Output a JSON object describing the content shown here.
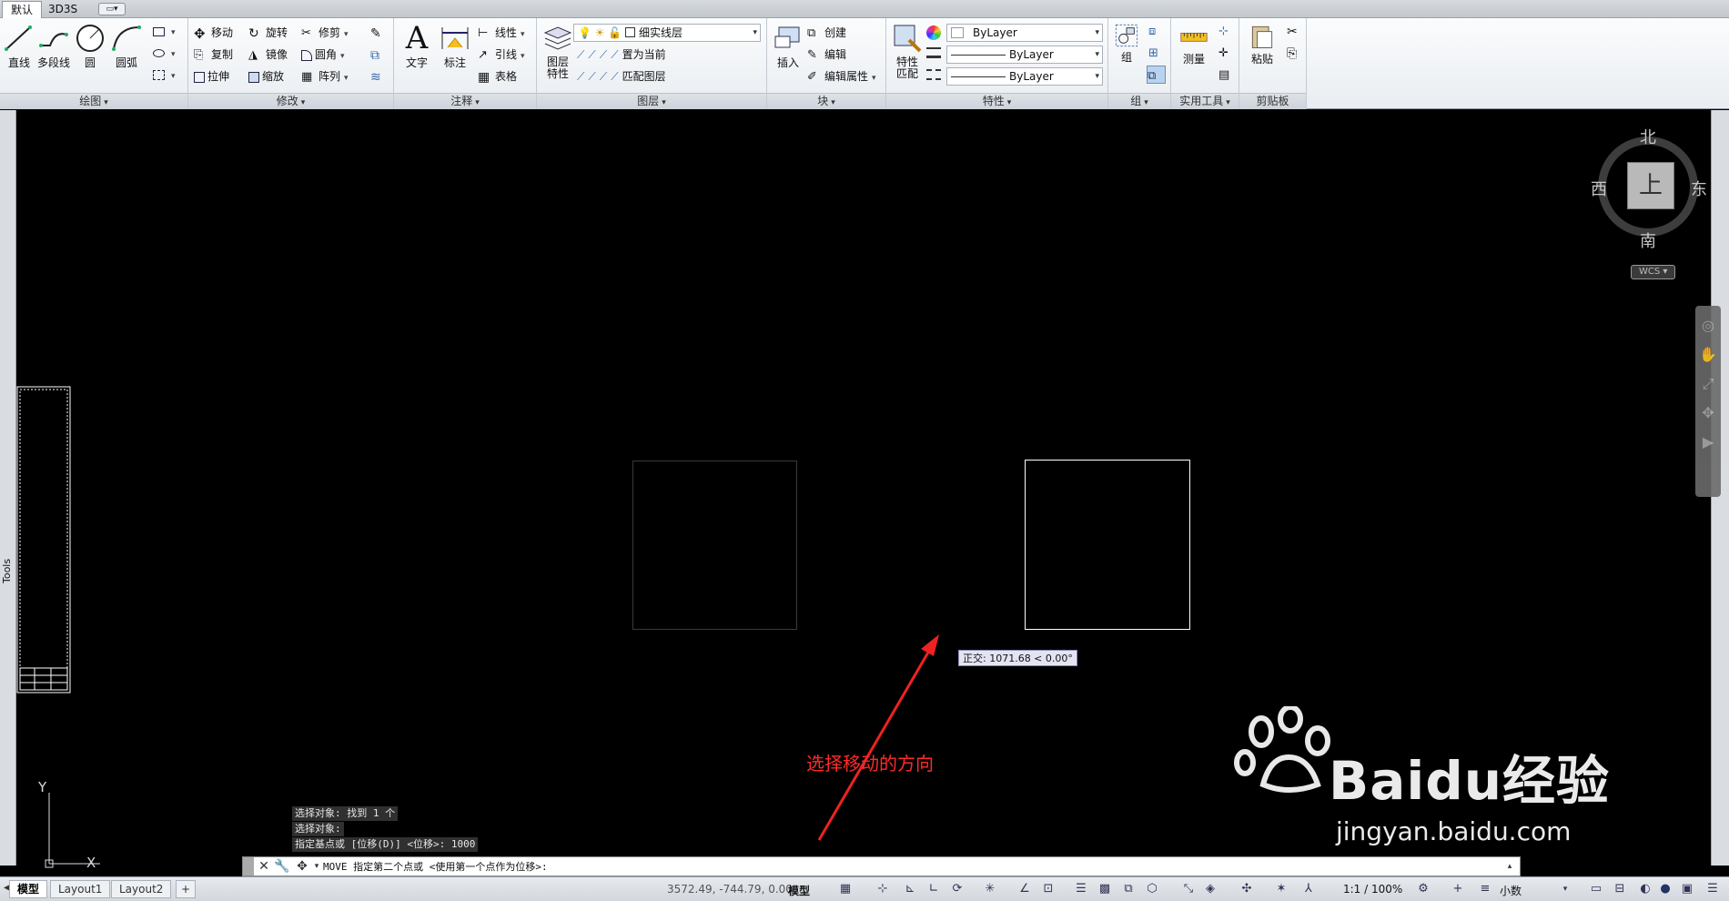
{
  "tabs": [
    "默认",
    "3D3S"
  ],
  "ribbon": {
    "draw": {
      "title": "绘图",
      "line": "直线",
      "polyline": "多段线",
      "circle": "圆",
      "arc": "圆弧"
    },
    "modify": {
      "title": "修改",
      "move": "移动",
      "rotate": "旋转",
      "trim": "修剪",
      "copy": "复制",
      "mirror": "镜像",
      "fillet": "圆角",
      "stretch": "拉伸",
      "scale": "缩放",
      "array": "阵列"
    },
    "annotation": {
      "title": "注释",
      "text": "文字",
      "dimension": "标注",
      "linear": "线性",
      "leader": "引线",
      "table": "表格"
    },
    "layers": {
      "title": "图层",
      "layer_props": "图层\n特性",
      "layer_combo": "细实线层",
      "set_current": "置为当前",
      "match_layer": "匹配图层"
    },
    "block": {
      "title": "块",
      "insert": "插入",
      "create": "创建",
      "edit": "编辑",
      "edit_attr": "编辑属性"
    },
    "properties": {
      "title": "特性",
      "match": "特性\n匹配",
      "color": "ByLayer",
      "lineweight": "ByLayer",
      "linetype": "ByLayer"
    },
    "groups": {
      "title": "组",
      "group": "组"
    },
    "utilities": {
      "title": "实用工具",
      "measure": "测量"
    },
    "clipboard": {
      "title": "剪贴板",
      "paste": "粘贴"
    }
  },
  "left_palette": "Tools",
  "viewcube": {
    "north": "北",
    "south": "南",
    "west": "西",
    "east": "东",
    "face": "上",
    "wcs": "WCS"
  },
  "canvas": {
    "tooltip": "正交: 1071.68 < 0.00°",
    "annotation": "选择移动的方向",
    "ucs_y": "Y",
    "ucs_x": "X"
  },
  "history": [
    "选择对象: 找到 1 个",
    "选择对象:",
    "指定基点或 [位移(D)] <位移>:  1000"
  ],
  "command_line": "MOVE 指定第二个点或 <使用第一个点作为位移>:",
  "status": {
    "tabs": [
      "模型",
      "Layout1",
      "Layout2"
    ],
    "coordinates": "3572.49, -744.79, 0.00",
    "model": "模型",
    "scale": "1:1 / 100%",
    "units": "小数"
  },
  "watermark": {
    "brand": "Baidu经验",
    "url": "jingyan.baidu.com"
  },
  "colors": {
    "ribbon_bg": "#f4f6f8",
    "canvas_bg": "#000000",
    "annotation": "#ff2a2a",
    "arrow": "#ee2222"
  }
}
